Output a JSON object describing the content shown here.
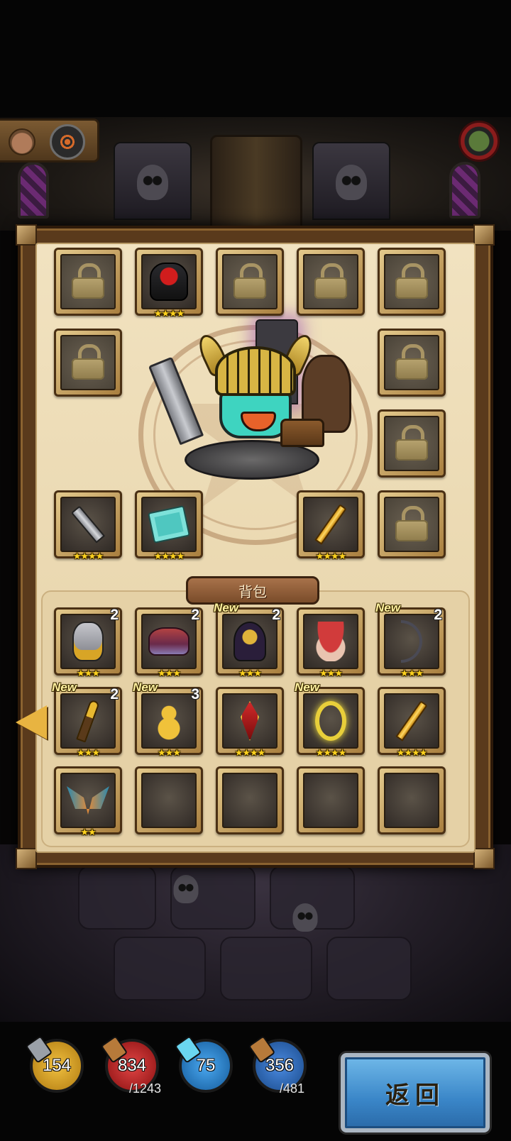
{
  "equipment": {
    "slots": [
      {
        "state": "locked"
      },
      {
        "state": "item",
        "icon": "dark-knight-icon",
        "stars": "★★★★"
      },
      {
        "state": "locked"
      },
      {
        "state": "locked"
      },
      {
        "state": "locked"
      },
      {
        "state": "locked"
      },
      {
        "state": "locked"
      },
      {
        "state": "locked"
      },
      {
        "state": "item",
        "icon": "dagger-icon",
        "stars": "★★★★"
      },
      {
        "state": "item",
        "icon": "map-icon",
        "stars": "★★★★"
      },
      {
        "state": "item",
        "icon": "golden-sword-icon",
        "stars": "★★★★"
      },
      {
        "state": "locked"
      }
    ]
  },
  "bag": {
    "title": "背包",
    "items": [
      {
        "icon": "gold-helmet-icon",
        "stars": "★★★",
        "count": "2",
        "new": ""
      },
      {
        "icon": "hat-icon",
        "stars": "★★★",
        "count": "2",
        "new": ""
      },
      {
        "icon": "ninja-helmet-icon",
        "stars": "★★★",
        "count": "2",
        "new": "New"
      },
      {
        "icon": "mushroom-icon",
        "stars": "★★★",
        "count": "",
        "new": ""
      },
      {
        "icon": "bow-icon",
        "stars": "★★★",
        "count": "2",
        "new": "New"
      },
      {
        "icon": "golden-staff-icon",
        "stars": "★★★",
        "count": "2",
        "new": "New"
      },
      {
        "icon": "gourd-staff-icon",
        "stars": "★★★",
        "count": "3",
        "new": "New"
      },
      {
        "icon": "red-pendant-icon",
        "stars": "★★★★",
        "count": "",
        "new": ""
      },
      {
        "icon": "gold-ring-icon",
        "stars": "★★★★",
        "count": "",
        "new": "New"
      },
      {
        "icon": "golden-sword-icon",
        "stars": "★★★★",
        "count": "",
        "new": ""
      },
      {
        "icon": "wings-icon",
        "stars": "★★",
        "count": "",
        "new": ""
      },
      {
        "icon": "empty-slot",
        "stars": "",
        "count": "",
        "new": ""
      },
      {
        "icon": "empty-slot",
        "stars": "",
        "count": "",
        "new": ""
      },
      {
        "icon": "empty-slot",
        "stars": "",
        "count": "",
        "new": ""
      },
      {
        "icon": "empty-slot",
        "stars": "",
        "count": "",
        "new": ""
      }
    ]
  },
  "resources": {
    "attack": {
      "value": "154",
      "color": "#d8a325"
    },
    "health": {
      "value": "834",
      "max": "/1243",
      "color": "#c2282a"
    },
    "mana": {
      "value": "75",
      "color": "#2a86d0"
    },
    "energy": {
      "value": "356",
      "max": "/481",
      "color": "#2a6ab8"
    }
  },
  "back_button": {
    "label": "返回"
  }
}
